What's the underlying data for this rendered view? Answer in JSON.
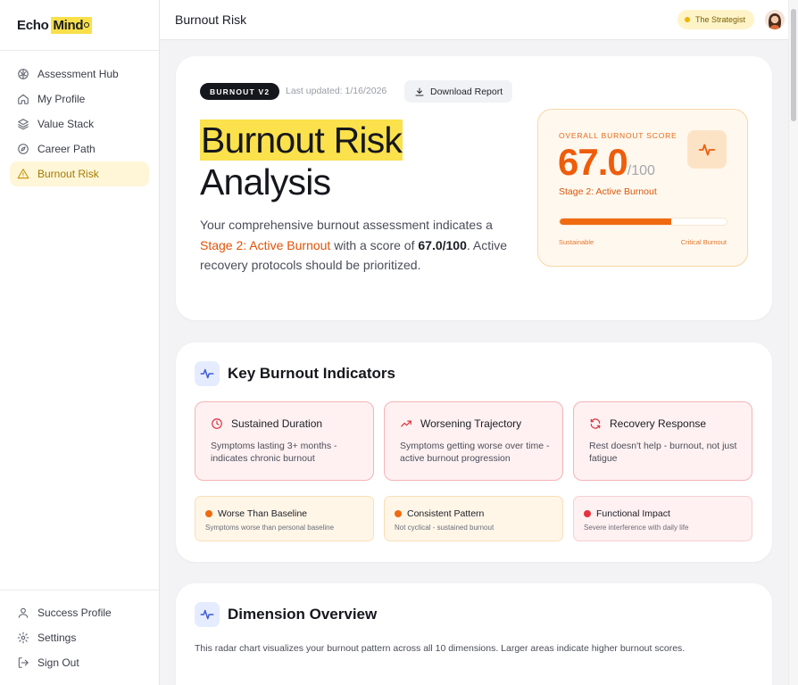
{
  "app": {
    "logo_text": "Echo",
    "logo_highlight": "Mind"
  },
  "sidebar": {
    "items": [
      {
        "label": "Assessment Hub",
        "icon": "brain-icon",
        "active": false
      },
      {
        "label": "My Profile",
        "icon": "home-icon",
        "active": false
      },
      {
        "label": "Value Stack",
        "icon": "layers-icon",
        "active": false
      },
      {
        "label": "Career Path",
        "icon": "compass-icon",
        "active": false
      },
      {
        "label": "Burnout Risk",
        "icon": "warning-icon",
        "active": true
      }
    ],
    "bottom_items": [
      {
        "label": "Success Profile",
        "icon": "user-icon"
      },
      {
        "label": "Settings",
        "icon": "gear-icon"
      },
      {
        "label": "Sign Out",
        "icon": "sign-out-icon"
      }
    ]
  },
  "header": {
    "title": "Burnout Risk",
    "persona": "The Strategist"
  },
  "hero": {
    "badge": "BURNOUT V2",
    "last_updated": "Last updated: 1/16/2026",
    "download_label": "Download Report",
    "title_highlight": "Burnout Risk",
    "title_rest": "Analysis",
    "desc_part1": "Your comprehensive burnout assessment indicates a ",
    "desc_stage": "Stage 2: Active Burnout",
    "desc_part2": " with a score of ",
    "desc_score": "67.0/100",
    "desc_part3": ". Active recovery protocols should be prioritized."
  },
  "score": {
    "label": "OVERALL BURNOUT SCORE",
    "value": "67.0",
    "max": "/100",
    "stage": "Stage 2: Active Burnout",
    "fill_percent": 67,
    "low_label": "Sustainable",
    "high_label": "Critical Burnout",
    "accent": "#ee5d0b"
  },
  "indicators": {
    "title": "Key Burnout Indicators",
    "cards": [
      {
        "title": "Sustained Duration",
        "desc": "Symptoms lasting 3+ months - indicates chronic burnout",
        "icon": "clock-icon"
      },
      {
        "title": "Worsening Trajectory",
        "desc": "Symptoms getting worse over time - active burnout progression",
        "icon": "trending-up-icon"
      },
      {
        "title": "Recovery Response",
        "desc": "Rest doesn't help - burnout, not just fatigue",
        "icon": "refresh-icon"
      }
    ],
    "small_cards": [
      {
        "title": "Worse Than Baseline",
        "desc": "Symptoms worse than personal baseline",
        "color": "#f06a10"
      },
      {
        "title": "Consistent Pattern",
        "desc": "Not cyclical - sustained burnout",
        "color": "#f06a10"
      },
      {
        "title": "Functional Impact",
        "desc": "Severe interference with daily life",
        "color": "#e8323c"
      }
    ]
  },
  "dimension": {
    "title": "Dimension Overview",
    "desc": "This radar chart visualizes your burnout pattern across all 10 dimensions. Larger areas indicate higher burnout scores."
  }
}
